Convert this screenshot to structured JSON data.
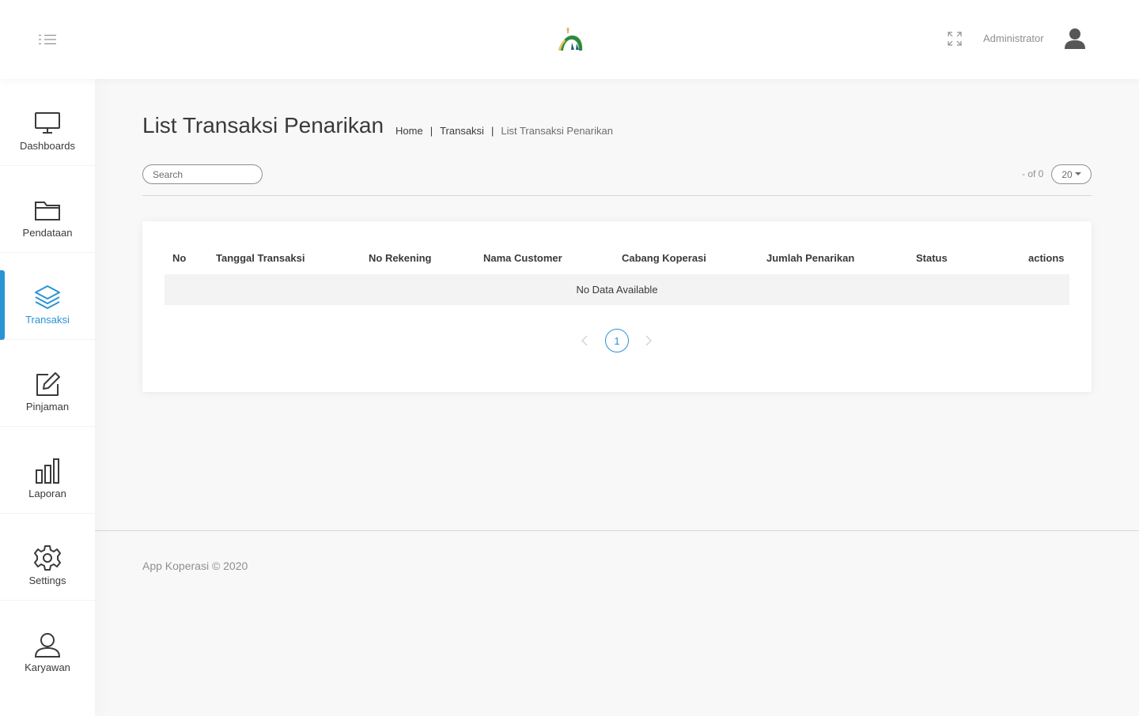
{
  "header": {
    "user_name": "Administrator",
    "menu_icon": "menu-icon",
    "fullscreen_icon": "fullscreen-icon",
    "avatar_icon": "user-avatar-icon"
  },
  "sidebar": {
    "items": [
      {
        "label": "Dashboards",
        "icon": "monitor-icon"
      },
      {
        "label": "Pendataan",
        "icon": "folder-icon"
      },
      {
        "label": "Transaksi",
        "icon": "layers-icon",
        "active": true
      },
      {
        "label": "Pinjaman",
        "icon": "edit-icon"
      },
      {
        "label": "Laporan",
        "icon": "bar-chart-icon"
      },
      {
        "label": "Settings",
        "icon": "gear-icon"
      },
      {
        "label": "Karyawan",
        "icon": "user-icon"
      }
    ],
    "active_color": "#2a93d5"
  },
  "page": {
    "title": "List Transaksi Penarikan",
    "breadcrumb": [
      "Home",
      "Transaksi",
      "List Transaksi Penarikan"
    ],
    "breadcrumb_separator": "|"
  },
  "toolbar": {
    "search_placeholder": "Search",
    "page_count": "- of 0",
    "per_page": "20"
  },
  "table": {
    "columns": [
      "No",
      "Tanggal Transaksi",
      "No Rekening",
      "Nama Customer",
      "Cabang Koperasi",
      "Jumlah Penarikan",
      "Status",
      "actions"
    ],
    "rows": [],
    "empty_message": "No Data Available"
  },
  "pagination": {
    "current_page": "1"
  },
  "footer": {
    "text": "App Koperasi © 2020"
  }
}
